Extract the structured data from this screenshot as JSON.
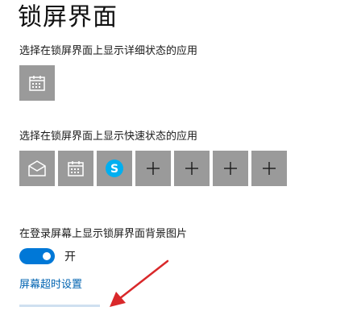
{
  "page": {
    "title": "锁屏界面"
  },
  "detailed_status": {
    "label": "选择在锁屏界面上显示详细状态的应用",
    "apps": [
      {
        "icon": "calendar-icon"
      }
    ]
  },
  "quick_status": {
    "label": "选择在锁屏界面上显示快速状态的应用",
    "apps": [
      {
        "icon": "mail-icon"
      },
      {
        "icon": "calendar-icon"
      },
      {
        "icon": "skype-icon"
      },
      {
        "icon": "plus-icon"
      },
      {
        "icon": "plus-icon"
      },
      {
        "icon": "plus-icon"
      },
      {
        "icon": "plus-icon"
      }
    ]
  },
  "background_on_signin": {
    "label": "在登录屏幕上显示锁屏界面背景图片",
    "toggle_state_text": "开",
    "toggle_on": true
  },
  "links": {
    "screen_timeout": "屏幕超时设置"
  },
  "colors": {
    "tile": "#9a9a9a",
    "accent": "#0078d7",
    "link": "#0063b1",
    "arrow": "#d9282a",
    "skype": "#00aff0"
  }
}
